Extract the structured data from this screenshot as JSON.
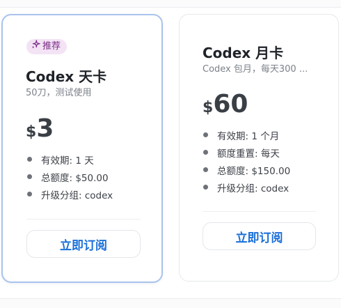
{
  "plans": [
    {
      "badge": {
        "icon": "sparkle-icon",
        "label": "推荐"
      },
      "title": "Codex 天卡",
      "subtitle": "50刀，测试使用",
      "currency": "$",
      "price": "3",
      "features": [
        "有效期: 1 天",
        "总额度: $50.00",
        "升级分组: codex"
      ],
      "button_label": "立即订阅"
    },
    {
      "title": "Codex 月卡",
      "subtitle": "Codex 包月，每天300 ...",
      "currency": "$",
      "price": "60",
      "features": [
        "有效期: 1 个月",
        "额度重置: 每天",
        "总额度: $150.00",
        "升级分组: codex"
      ],
      "button_label": "立即订阅"
    }
  ],
  "colors": {
    "accent": "#1a6fd8",
    "selected_border": "#a9c3ec",
    "badge_bg": "#f3e3f5",
    "badge_text": "#7a2d86"
  }
}
